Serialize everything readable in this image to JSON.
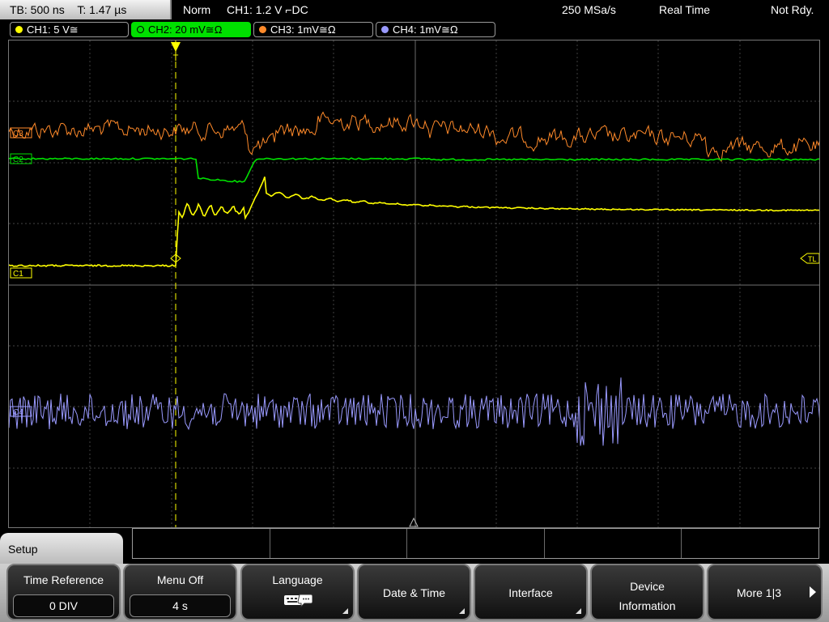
{
  "status_bar": {
    "timebase": "TB: 500 ns",
    "trigger_time": "T: 1.47 µs",
    "trigger_mode": "Norm",
    "trigger_source": "CH1: 1.2 V ⌐DC",
    "sample_rate": "250 MSa/s",
    "acq_mode": "Real Time",
    "state": "Not Rdy."
  },
  "channels": [
    {
      "label": "CH1: 5 V≅",
      "color": "#ffff00",
      "active": false
    },
    {
      "label": "CH2: 20 mV≅Ω",
      "color": "#00e000",
      "active": true
    },
    {
      "label": "CH3: 1mV≅Ω",
      "color": "#ff8a2a",
      "active": false
    },
    {
      "label": "CH4: 1mV≅Ω",
      "color": "#9a9aff",
      "active": false
    }
  ],
  "markers": {
    "ch3": "C3",
    "ch2": "C2",
    "ch1": "C1",
    "ch4": "C4",
    "trigger_level": "TL",
    "trigger_pos": "T"
  },
  "menu": {
    "title": "Setup",
    "softkeys": [
      {
        "title": "Time Reference",
        "value": "0 DIV"
      },
      {
        "title": "Menu Off",
        "value": "4 s"
      },
      {
        "title": "Language",
        "icon": "keyboard-icon"
      },
      {
        "title": "Date & Time"
      },
      {
        "title": "Interface"
      },
      {
        "title": "Device\nInformation"
      },
      {
        "title": "More 1|3"
      }
    ]
  },
  "colors": {
    "ch1": "#ffff00",
    "ch2": "#00e000",
    "ch3": "#ff8a2a",
    "ch4": "#9a9aff",
    "grid": "#5a5a5a"
  }
}
